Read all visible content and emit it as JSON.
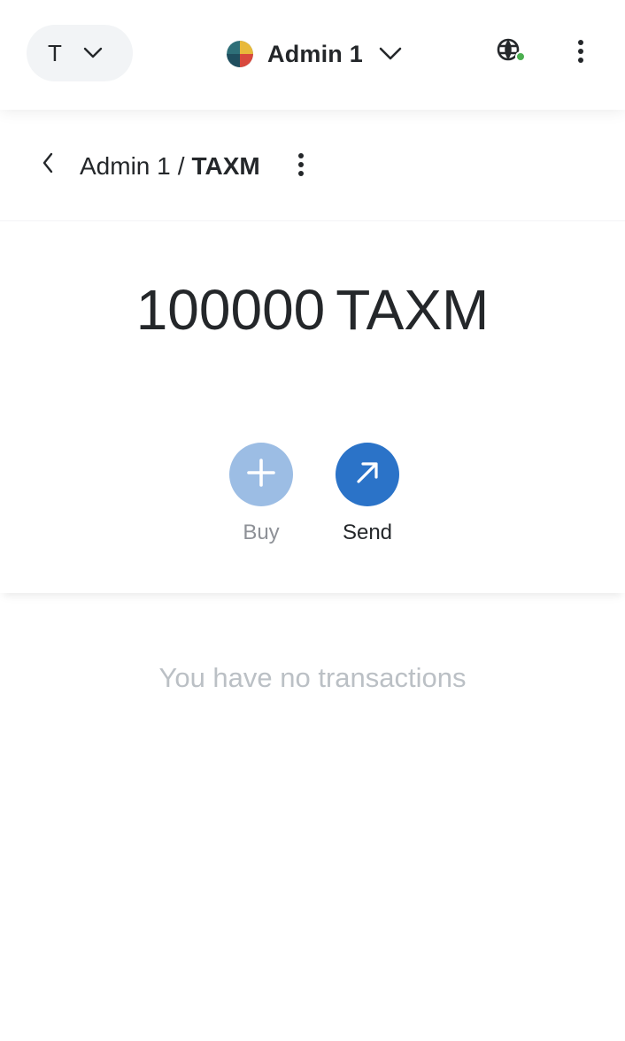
{
  "header": {
    "network_label": "T",
    "account_name": "Admin 1",
    "icons": {
      "network_chevron": "chevron-down-icon",
      "account_chevron": "chevron-down-icon",
      "connection": "globe-icon",
      "menu": "kebab-menu-icon"
    },
    "connection_status_color": "#4caf50"
  },
  "breadcrumb": {
    "account": "Admin 1",
    "separator": "/",
    "token": "TAXM",
    "icons": {
      "back": "chevron-left-icon",
      "menu": "kebab-menu-icon"
    }
  },
  "overview": {
    "balance_amount": "100000",
    "balance_symbol": "TAXM",
    "actions": [
      {
        "label": "Buy",
        "icon": "plus-icon",
        "color": "#9cbde4"
      },
      {
        "label": "Send",
        "icon": "arrow-up-right-icon",
        "color": "#2b73c8"
      }
    ]
  },
  "transactions": {
    "empty_message": "You have no transactions"
  }
}
